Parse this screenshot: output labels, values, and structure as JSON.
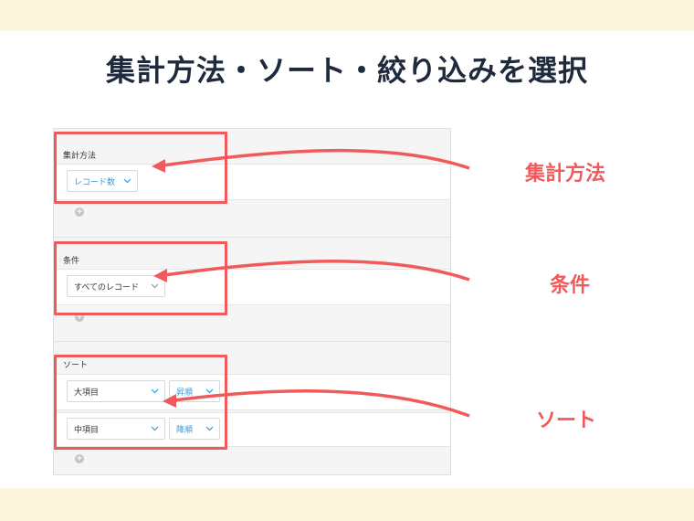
{
  "slide": {
    "title": "集計方法・ソート・絞り込みを選択"
  },
  "panel": {
    "aggregation": {
      "label": "集計方法",
      "dropdown_value": "レコード数"
    },
    "condition": {
      "label": "条件",
      "dropdown_value": "すべてのレコード"
    },
    "sort": {
      "label": "ソート",
      "rows": [
        {
          "field": "大項目",
          "order": "昇順"
        },
        {
          "field": "中項目",
          "order": "降順"
        }
      ]
    },
    "add_symbol": "+"
  },
  "callouts": {
    "aggregation": "集計方法",
    "condition": "条件",
    "sort": "ソート"
  },
  "colors": {
    "accent": "#f05a5a",
    "link_blue": "#3498db",
    "title": "#1f2b3d",
    "band": "#fdf6de"
  },
  "icons": {
    "dropdown": "chevron-down-icon",
    "add": "plus-circle-icon",
    "callout": "arrow-icon"
  }
}
